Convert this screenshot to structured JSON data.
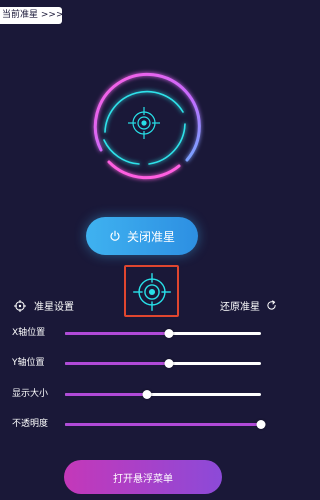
{
  "top_tag": {
    "label": "当前准星 >>>"
  },
  "main": {
    "close_button_label": "关闭准星",
    "settings_label": "准星设置",
    "reset_label": "还原准星"
  },
  "sliders": [
    {
      "label": "X轴位置",
      "value": 0.53
    },
    {
      "label": "Y轴位置",
      "value": 0.53
    },
    {
      "label": "显示大小",
      "value": 0.42
    },
    {
      "label": "不透明度",
      "value": 1.0
    }
  ],
  "footer": {
    "float_menu_label": "打开悬浮菜单"
  },
  "colors": {
    "background": "#1a1838",
    "accent_blue": "#3fb2f0",
    "accent_purple": "#b04ad8",
    "accent_pink": "#ff3fd6",
    "crosshair_cyan": "#28e0e8",
    "highlight_red": "#e0462f"
  },
  "icons": {
    "crosshair": "crosshair-icon",
    "power": "power-icon",
    "target": "target-icon",
    "refresh": "refresh-icon"
  }
}
